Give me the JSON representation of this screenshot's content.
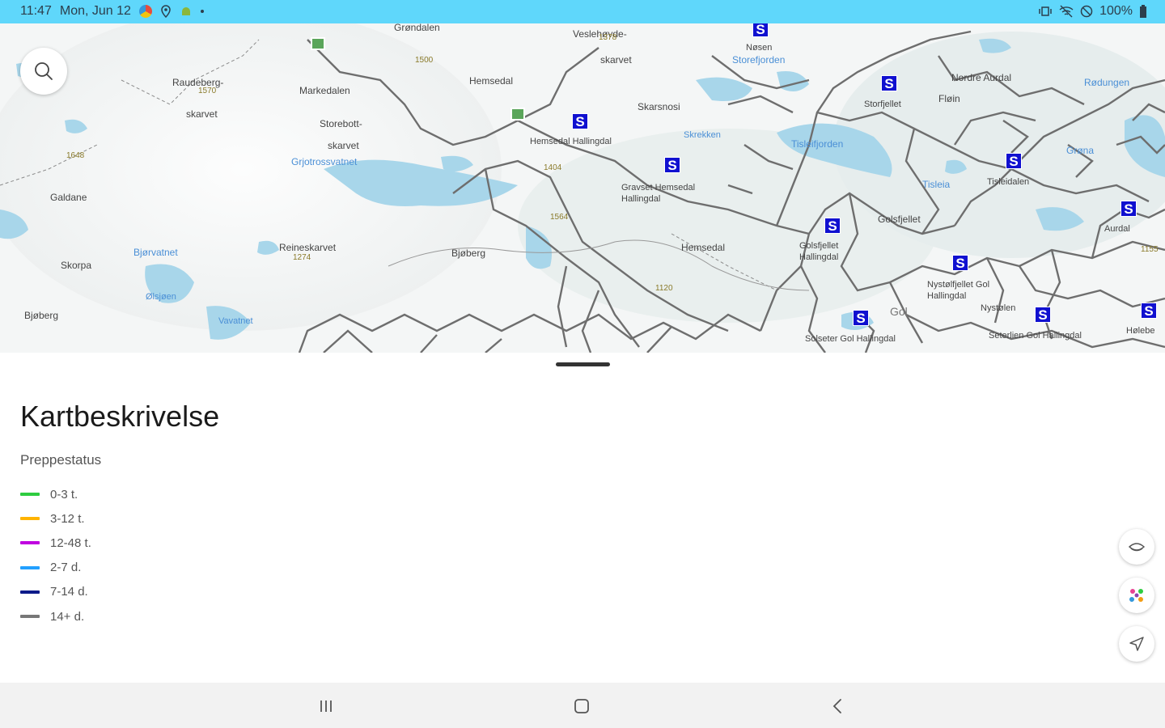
{
  "status_bar": {
    "time": "11:47",
    "date": "Mon, Jun 12",
    "battery": "100%",
    "icons_left": [
      "app-notification-icon",
      "location-icon",
      "android-icon",
      "dot-icon"
    ],
    "icons_right": [
      "vibrate-icon",
      "wifi-off-icon",
      "dnd-icon",
      "battery-icon"
    ]
  },
  "map": {
    "labels": [
      {
        "text": "Grøndalen",
        "cls": ""
      },
      {
        "text": "Veslehøvde-",
        "cls": ""
      },
      {
        "text": "skarvet",
        "cls": ""
      },
      {
        "text": "Hemsedal",
        "cls": ""
      },
      {
        "text": "Raudeberg-",
        "cls": ""
      },
      {
        "text": "skarvet",
        "cls": ""
      },
      {
        "text": "Markedalen",
        "cls": ""
      },
      {
        "text": "Storebott-",
        "cls": ""
      },
      {
        "text": "skarvet",
        "cls": ""
      },
      {
        "text": "Grjotrossvatnet",
        "cls": "water"
      },
      {
        "text": "Galdane",
        "cls": ""
      },
      {
        "text": "Skorpa",
        "cls": ""
      },
      {
        "text": "Reineskarvet",
        "cls": ""
      },
      {
        "text": "Bjøberg",
        "cls": ""
      },
      {
        "text": "Hemsedal Hallingdal",
        "cls": ""
      },
      {
        "text": "Skarsnosi",
        "cls": ""
      },
      {
        "text": "Gravset Hemsedal Hallingdal",
        "cls": ""
      },
      {
        "text": "Hemsedal",
        "cls": ""
      },
      {
        "text": "Golsfjellet",
        "cls": ""
      },
      {
        "text": "Golsfjellet Hallingdal",
        "cls": ""
      },
      {
        "text": "Storefjorden",
        "cls": "water"
      },
      {
        "text": "Tisleia",
        "cls": "water"
      },
      {
        "text": "Tisleifjorden",
        "cls": "water"
      },
      {
        "text": "Nordre Aurdal",
        "cls": ""
      },
      {
        "text": "Fløin",
        "cls": ""
      },
      {
        "text": "Storfjellet",
        "cls": ""
      },
      {
        "text": "Tisleidalen",
        "cls": ""
      },
      {
        "text": "Nystølfjellet Gol Hallingdal",
        "cls": ""
      },
      {
        "text": "Nystølen",
        "cls": ""
      },
      {
        "text": "Gol",
        "cls": ""
      },
      {
        "text": "Solseter Gol Hallingdal",
        "cls": ""
      },
      {
        "text": "Seterlien Gol Hallingdal",
        "cls": ""
      },
      {
        "text": "Hølebe",
        "cls": ""
      },
      {
        "text": "Nøsen",
        "cls": ""
      },
      {
        "text": "Bjøberg",
        "cls": ""
      },
      {
        "text": "Aurdal",
        "cls": ""
      },
      {
        "text": "Bjørvatnet",
        "cls": "water"
      },
      {
        "text": "Rødungen",
        "cls": "water"
      },
      {
        "text": "Vavatnet",
        "cls": "water"
      },
      {
        "text": "Grøna",
        "cls": "water"
      },
      {
        "text": "Ølsjøen",
        "cls": "water"
      },
      {
        "text": "Skrekken",
        "cls": "water"
      }
    ],
    "elevations": [
      "1500",
      "1378",
      "1648",
      "1404",
      "1564",
      "1120",
      "1274",
      "1570",
      "1155"
    ],
    "station_marker_label": "S"
  },
  "sheet": {
    "title": "Kartbeskrivelse",
    "subtitle": "Preppestatus",
    "legend": [
      {
        "label": "0-3 t.",
        "color": "#2ecc40"
      },
      {
        "label": "3-12 t.",
        "color": "#ffb300"
      },
      {
        "label": "12-48 t.",
        "color": "#c000e0"
      },
      {
        "label": "2-7 d.",
        "color": "#22a0ff"
      },
      {
        "label": "7-14 d.",
        "color": "#0d1a8a"
      },
      {
        "label": "14+ d.",
        "color": "#777777"
      }
    ]
  },
  "fabs": [
    "layers-icon",
    "palette-icon",
    "navigation-icon"
  ],
  "nav": [
    "recents-icon",
    "home-icon",
    "back-icon"
  ]
}
